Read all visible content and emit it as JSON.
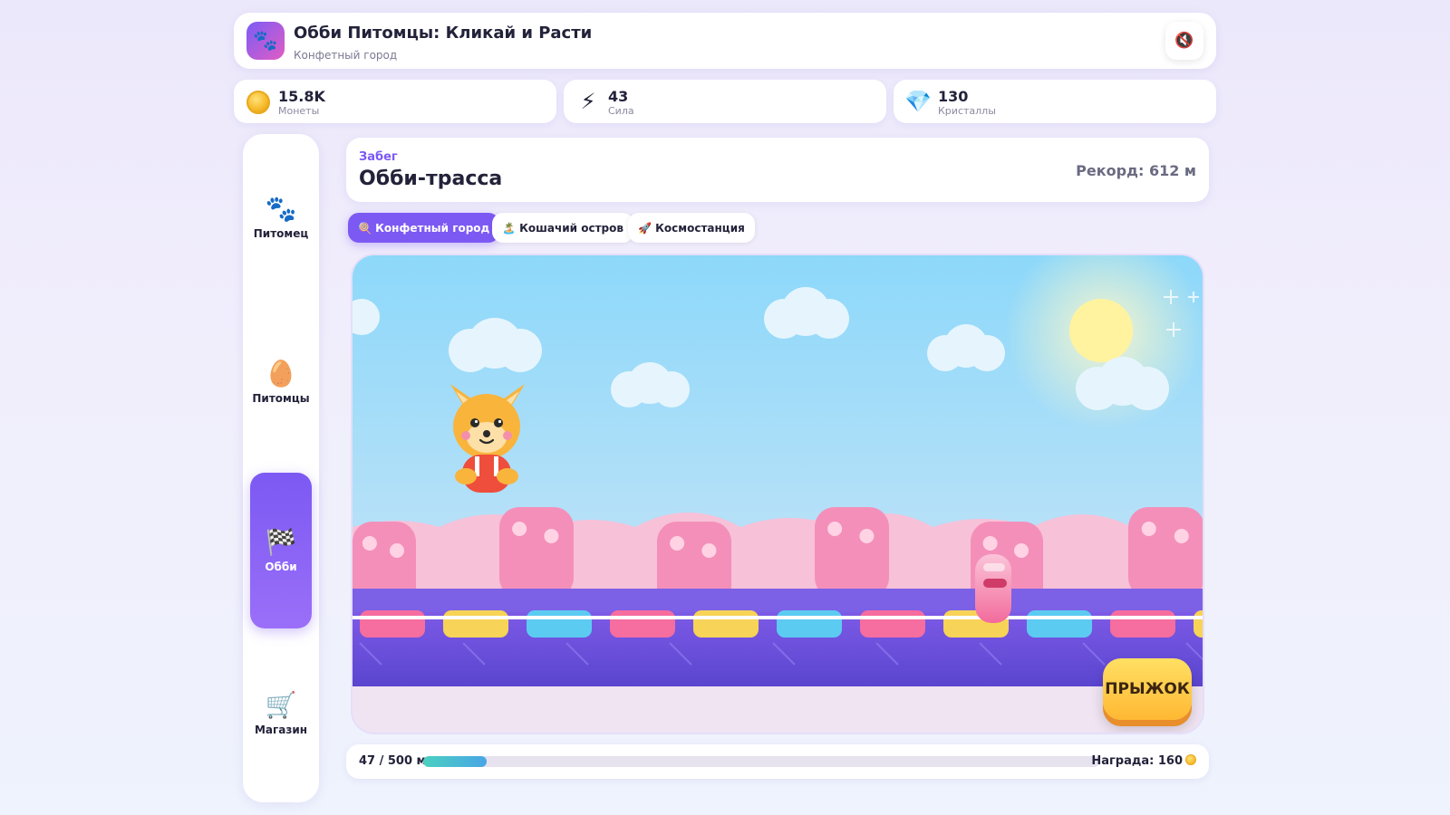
{
  "app": {
    "title": "Обби Питомцы: Кликай и Расти",
    "subtitle": "Конфетный город",
    "logo_icon": "🐾",
    "sound_icon": "🔇"
  },
  "stats": [
    {
      "id": "coins",
      "icon": "coin-icon",
      "value": "15.8K",
      "label": "Монеты"
    },
    {
      "id": "power",
      "icon": "⚡",
      "value": "43",
      "label": "Сила"
    },
    {
      "id": "crystals",
      "icon": "💎",
      "value": "130",
      "label": "Кристаллы"
    }
  ],
  "sidebar": {
    "items": [
      {
        "id": "pet",
        "icon": "🐾",
        "label": "Питомец",
        "active": false
      },
      {
        "id": "pets",
        "icon": "🥚",
        "label": "Питомцы",
        "active": false
      },
      {
        "id": "obby",
        "icon": "🏁",
        "label": "Обби",
        "active": true
      },
      {
        "id": "shop",
        "icon": "🛒",
        "label": "Магазин",
        "active": false
      }
    ]
  },
  "mode": {
    "kicker": "Забег",
    "title": "Обби-трасса",
    "record": "Рекорд: 612 м"
  },
  "worlds": {
    "tabs": [
      {
        "label": "🍭 Конфетный город",
        "active": true
      },
      {
        "label": "🏝️ Кошачий остров",
        "active": false
      },
      {
        "label": "🚀 Космостанция",
        "active": false
      }
    ]
  },
  "game": {
    "jump_label": "ПРЫЖОК",
    "colors": {
      "sky_top": "#8dd8fa",
      "sky_bottom": "#c2e3f7",
      "hills": "#f7c1d8",
      "candy_pink": "#f48fba",
      "track": "#6a4fd6",
      "track_dark": "#5a45cf",
      "tile_pink": "#f66d9f",
      "tile_yellow": "#f7d357",
      "tile_blue": "#5ccbf2",
      "sun": "#fff3a0",
      "fox_orange": "#f9b43c",
      "shirt_red": "#ee4e3b"
    }
  },
  "progress": {
    "label": "47 / 500 м",
    "current": 47,
    "total": 500,
    "reward": "Награда: 160"
  }
}
